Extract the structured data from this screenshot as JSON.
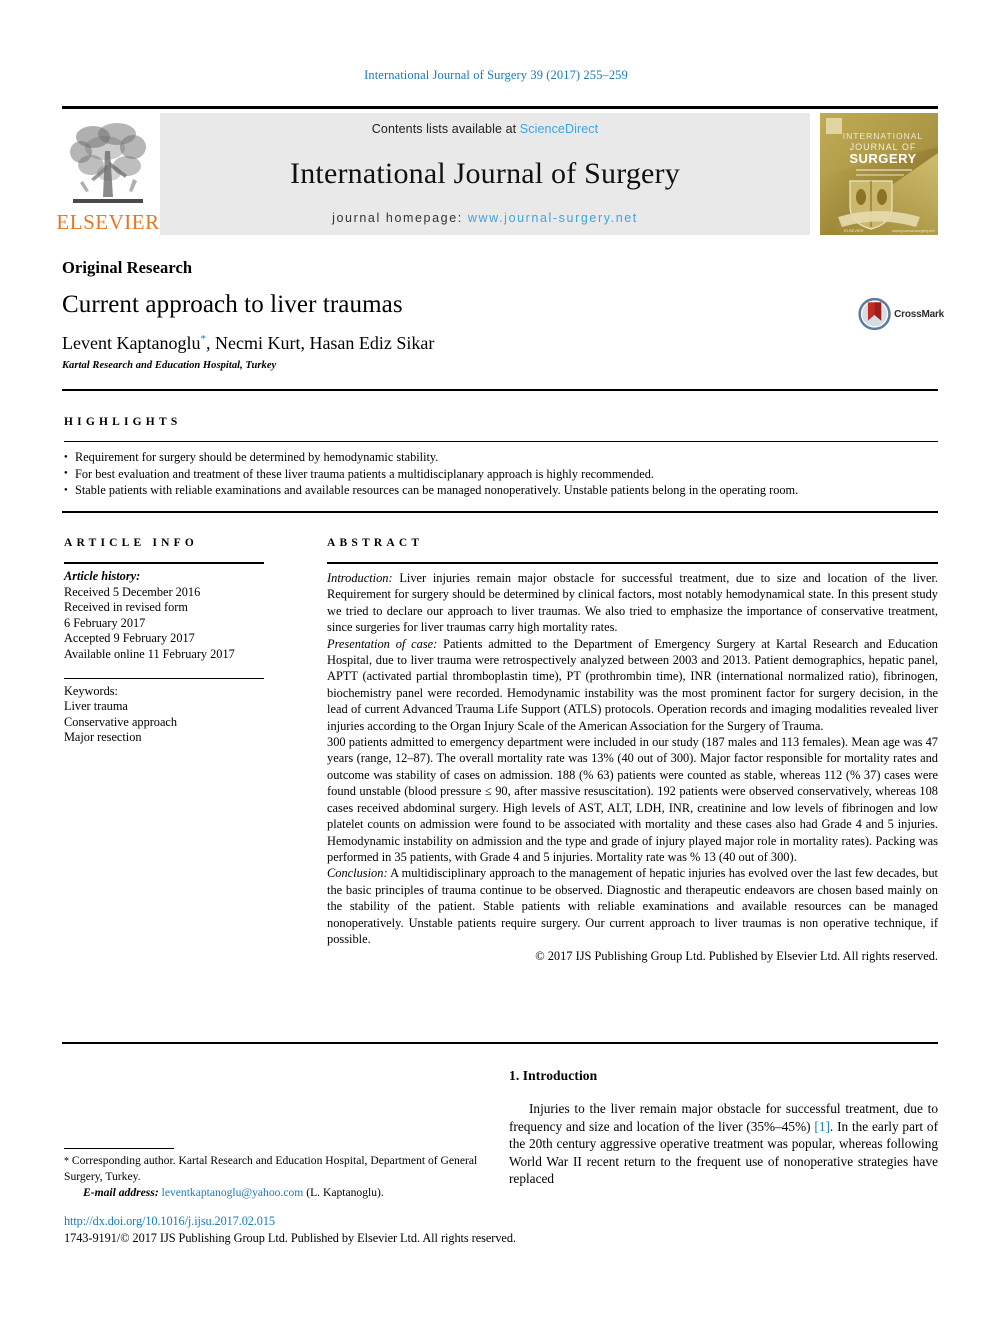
{
  "running_head": "International Journal of Surgery 39 (2017) 255–259",
  "masthead": {
    "contents_prefix": "Contents lists available at ",
    "sciencedirect": "ScienceDirect",
    "journal_name": "International Journal of Surgery",
    "homepage_prefix": "journal homepage: ",
    "homepage_url": "www.journal-surgery.net",
    "publisher_wordmark": "ELSEVIER",
    "cover_title_line1": "INTERNATIONAL",
    "cover_title_line2": "JOURNAL OF",
    "cover_title_line3": "SURGERY",
    "cover_footer": "www.journal-surgery.net"
  },
  "article": {
    "kicker": "Original Research",
    "title": "Current approach to liver traumas",
    "authors": "Levent Kaptanoglu",
    "authors_rest": ", Necmi Kurt, Hasan Ediz Sikar",
    "corresponding_marker": "*",
    "affiliation": "Kartal Research and Education Hospital, Turkey",
    "crossmark_label": "CrossMark"
  },
  "highlights": {
    "heading": "HIGHLIGHTS",
    "items": [
      "Requirement for surgery should be determined by hemodynamic stability.",
      "For best evaluation and treatment of these liver trauma patients a multidisciplanary approach is highly recommended.",
      "Stable patients with reliable examinations and available resources can be managed nonoperatively. Unstable patients belong in the operating room."
    ]
  },
  "article_info": {
    "heading": "ARTICLE INFO",
    "history_label": "Article history:",
    "history_lines": [
      "Received 5 December 2016",
      "Received in revised form",
      "6 February 2017",
      "Accepted 9 February 2017",
      "Available online 11 February 2017"
    ],
    "keywords_label": "Keywords:",
    "keywords": [
      "Liver trauma",
      "Conservative approach",
      "Major resection"
    ]
  },
  "abstract": {
    "heading": "ABSTRACT",
    "intro_label": "Introduction:",
    "intro_text": " Liver injuries remain major obstacle for successful treatment, due to size and location of the liver. Requirement for surgery should be determined by clinical factors, most notably hemodynamical state. In this present study we tried to declare our approach to liver traumas. We also tried to emphasize the importance of conservative treatment, since surgeries for liver traumas carry high mortality rates.",
    "presentation_label": "Presentation of case:",
    "presentation_text": " Patients admitted to the Department of Emergency Surgery at Kartal Research and Education Hospital, due to liver trauma were retrospectively analyzed between 2003 and 2013. Patient demographics, hepatic panel, APTT (activated partial thromboplastin time), PT (prothrombin time), INR (international normalized ratio), fibrinogen, biochemistry panel were recorded. Hemodynamic instability was the most prominent factor for surgery decision, in the lead of current Advanced Trauma Life Support (ATLS) protocols. Operation records and imaging modalities revealed liver injuries according to the Organ Injury Scale of the American Association for the Surgery of Trauma.",
    "results_text": "300 patients admitted to emergency department were included in our study (187 males and 113 females). Mean age was 47 years (range, 12–87). The overall mortality rate was 13% (40 out of 300). Major factor responsible for mortality rates and outcome was stability of cases on admission. 188 (% 63) patients were counted as stable, whereas 112 (% 37) cases were found unstable (blood pressure ≤ 90, after massive resuscitation). 192 patients were observed conservatively, whereas 108 cases received abdominal surgery. High levels of AST, ALT, LDH, INR, creatinine and low levels of fibrinogen and low platelet counts on admission were found to be associated with mortality and these cases also had Grade 4 and 5 injuries. Hemodynamic instability on admission and the type and grade of injury played major role in mortality rates). Packing was performed in 35 patients, with Grade 4 and 5 injuries. Mortality rate was % 13 (40 out of 300).",
    "conclusion_label": "Conclusion:",
    "conclusion_text": " A multidisciplinary approach to the management of hepatic injuries has evolved over the last few decades, but the basic principles of trauma continue to be observed. Diagnostic and therapeutic endeavors are chosen based mainly on the stability of the patient. Stable patients with reliable examinations and available resources can be managed nonoperatively. Unstable patients require surgery. Our current approach to liver traumas is non operative technique, if possible.",
    "copyright": "© 2017 IJS Publishing Group Ltd. Published by Elsevier Ltd. All rights reserved."
  },
  "introduction": {
    "heading": "1. Introduction",
    "paragraph_a": "Injuries to the liver remain major obstacle for successful treatment, due to frequency and size and location of the liver (35%–45%) ",
    "reference": "[1]",
    "paragraph_b": ". In the early part of the 20th century aggressive operative treatment was popular, whereas following World War II recent return to the frequent use of nonoperative strategies have replaced"
  },
  "footnote": {
    "corresponding_marker": "*",
    "corresponding_text": " Corresponding author. Kartal Research and Education Hospital, Department of General Surgery, Turkey.",
    "email_label": "E-mail address:",
    "email": "leventkaptanoglu@yahoo.com",
    "email_suffix": " (L. Kaptanoglu).",
    "doi": "http://dx.doi.org/10.1016/j.ijsu.2017.02.015",
    "issn_line": "1743-9191/© 2017 IJS Publishing Group Ltd. Published by Elsevier Ltd. All rights reserved."
  },
  "colors": {
    "link_blue": "#1a7bb9",
    "sciencedirect_blue": "#3aa7dd",
    "elsevier_orange": "#e87722",
    "masthead_grey": "#e9e9e9"
  }
}
